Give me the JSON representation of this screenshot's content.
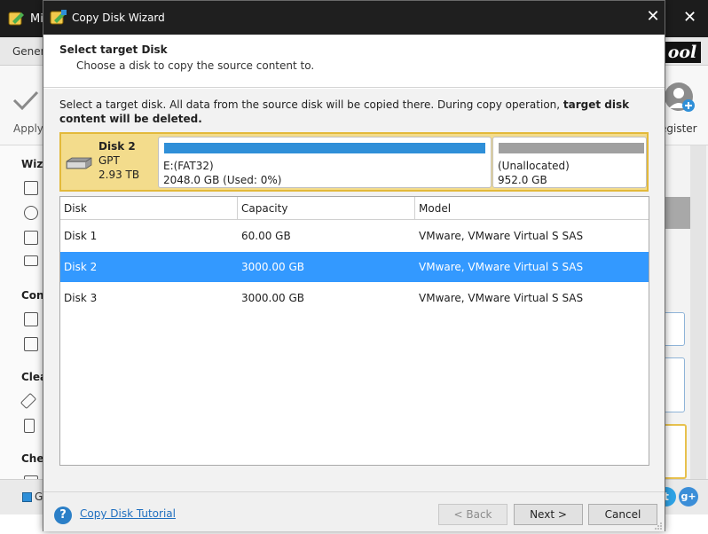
{
  "background_app": {
    "title_visible": "Mi",
    "menu_visible": "Gener",
    "brand_text": "ool",
    "apply_label": "Apply",
    "register_label": "egister",
    "sidebar_sections": [
      "Wiz",
      "Con",
      "Clea",
      "Che"
    ],
    "legend_text": "G"
  },
  "dialog": {
    "title": "Copy Disk Wizard",
    "close_glyph": "✕",
    "heading": "Select target Disk",
    "subheading": "Choose a disk to copy the source content to.",
    "instruction_normal": "Select a target disk. All data from the source disk will be copied there. During copy operation, ",
    "instruction_bold": "target disk content will be deleted",
    "instruction_end": "."
  },
  "disk_map": {
    "name": "Disk 2",
    "style": "GPT",
    "size": "2.93 TB",
    "partitions": [
      {
        "label": "E:(FAT32)",
        "detail": "2048.0 GB (Used: 0%)",
        "used_fraction": 0.0,
        "color": "#2f8fd8"
      },
      {
        "label": "(Unallocated)",
        "detail": "952.0 GB",
        "color": "#a0a0a0"
      }
    ]
  },
  "table": {
    "columns": [
      "Disk",
      "Capacity",
      "Model"
    ],
    "rows": [
      {
        "disk": "Disk 1",
        "capacity": "60.00 GB",
        "model": "VMware, VMware Virtual S SAS",
        "selected": false
      },
      {
        "disk": "Disk 2",
        "capacity": "3000.00 GB",
        "model": "VMware, VMware Virtual S SAS",
        "selected": true
      },
      {
        "disk": "Disk 3",
        "capacity": "3000.00 GB",
        "model": "VMware, VMware Virtual S SAS",
        "selected": false
      }
    ]
  },
  "footer": {
    "help_glyph": "?",
    "tutorial_link": "Copy Disk Tutorial",
    "back_label": "< Back",
    "next_label": "Next >",
    "cancel_label": "Cancel"
  },
  "colors": {
    "selection": "#3399ff",
    "disk_map_bg": "#f3dc8c",
    "disk_map_border": "#e3b93a",
    "partition_used": "#2f8fd8",
    "unallocated": "#a0a0a0"
  }
}
